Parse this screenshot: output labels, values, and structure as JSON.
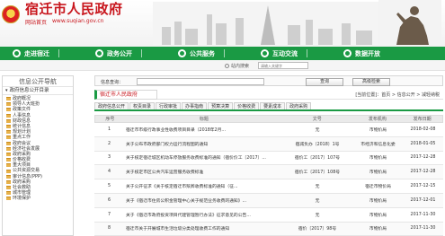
{
  "header": {
    "site_title": "宿迁市人民政府",
    "site_sub": "网站首页",
    "url": "www.suqian.gov.cn"
  },
  "nav": {
    "items": [
      {
        "label": "走进宿迁",
        "icon": "building-icon"
      },
      {
        "label": "政务公开",
        "icon": "document-icon"
      },
      {
        "label": "公共服务",
        "icon": "service-icon"
      },
      {
        "label": "互动交流",
        "icon": "chat-icon"
      },
      {
        "label": "数据开放",
        "icon": "data-icon"
      }
    ]
  },
  "site_search": {
    "label": "站内搜索",
    "placeholder": "请输入关键字"
  },
  "sidebar": {
    "title": "信息公开导航",
    "tree_head": "政府信息公开目录",
    "items": [
      "政府概况",
      "领导人大班扮",
      "政策文件",
      "人事信息",
      "财政信息",
      "统计信息",
      "规划计划",
      "重点工作",
      "政府会议",
      "经济社会发展",
      "政府采购",
      "价格收费",
      "重大项目",
      "公共资源交易",
      "审计信息(PPP)",
      "政府采购",
      "社会救助",
      "城市管理",
      "环境保护"
    ]
  },
  "info_search": {
    "label": "信息查询：",
    "query_btn": "查询",
    "reset_btn": "高级检索"
  },
  "crumb": {
    "title": "宿迁市人民政府",
    "path": "[当前位置]：首页 > 信息公开 > 减轻纳税"
  },
  "tabs": [
    "政府信息公开",
    "权责目录",
    "行政审批",
    "办事指南",
    "预算决算",
    "价格收费",
    "要素成本",
    "政府采购"
  ],
  "table": {
    "headers": {
      "no": "序号",
      "title": "标题",
      "doc": "文号",
      "org": "发布机构",
      "date": "发布日期"
    },
    "rows": [
      {
        "no": "1",
        "title": "宿迁市市级行政事业性收费项目目录（2018年2月...",
        "doc": "无",
        "org": "市物价局",
        "date": "2018-02-08"
      },
      {
        "no": "2",
        "title": "关于公布市政府部门权力运行流程图的通知",
        "doc": "宿减负办〔2018〕1号",
        "org": "市经济和信息化委",
        "date": "2018-01-05"
      },
      {
        "no": "3",
        "title": "关于核定宿迁城区机动车停放服务收费标准的通知（宿价价工〔2017〕...",
        "doc": "宿价工〔2017〕107号",
        "org": "市物价局",
        "date": "2017-12-28"
      },
      {
        "no": "4",
        "title": "关于核定市区公共汽车运营服务收费标准",
        "doc": "宿价工〔2017〕108号",
        "org": "市物价局",
        "date": "2017-12-28"
      },
      {
        "no": "5",
        "title": "关于公开征求《关于核定宿迁市殡葬收费标准的通知（征...",
        "doc": "无",
        "org": "宿迁市物价局",
        "date": "2017-12-15"
      },
      {
        "no": "6",
        "title": "关于《宿迁市住房公积金管理中心关于规范业务收费的通知》...",
        "doc": "无",
        "org": "市物价局",
        "date": "2017-12-01"
      },
      {
        "no": "7",
        "title": "关于《宿迁市政府投资项目代建管理暂行办法》征求意见的公告...",
        "doc": "无",
        "org": "市物价局",
        "date": "2017-11-30"
      },
      {
        "no": "8",
        "title": "宿迁市关于开展城市生活垃圾分类处理收费工作的通知",
        "doc": "宿价〔2017〕98号",
        "org": "市物价局",
        "date": "2017-11-30"
      }
    ]
  },
  "colors": {
    "brand_red": "#c8161d",
    "nav_green": "#1a9a44"
  }
}
